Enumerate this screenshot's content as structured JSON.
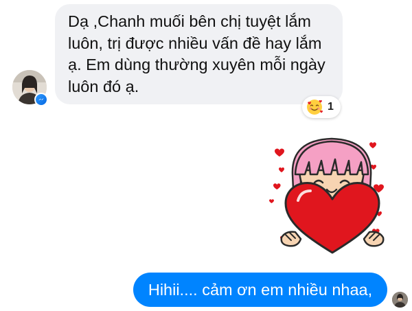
{
  "incoming": {
    "text": "Dạ ,Chanh muối bên chị tuyệt lắm\nluôn, trị được nhiều vấn đề hay lắm\nạ. Em dùng thường xuyên mỗi ngày\nluôn đó ạ.",
    "bubble_color": "#f0f1f4",
    "reaction": {
      "emoji": "smiling-face-with-hearts",
      "count": "1"
    },
    "badge_icon": "messenger-icon"
  },
  "sticker": {
    "icon": "girl-holding-heart-sticker",
    "heart_color": "#e0161e",
    "hair_color": "#f5a0c4"
  },
  "outgoing": {
    "text": "Hihii.... cảm ơn em nhiều nhaa,",
    "bubble_color": "#0084ff"
  }
}
